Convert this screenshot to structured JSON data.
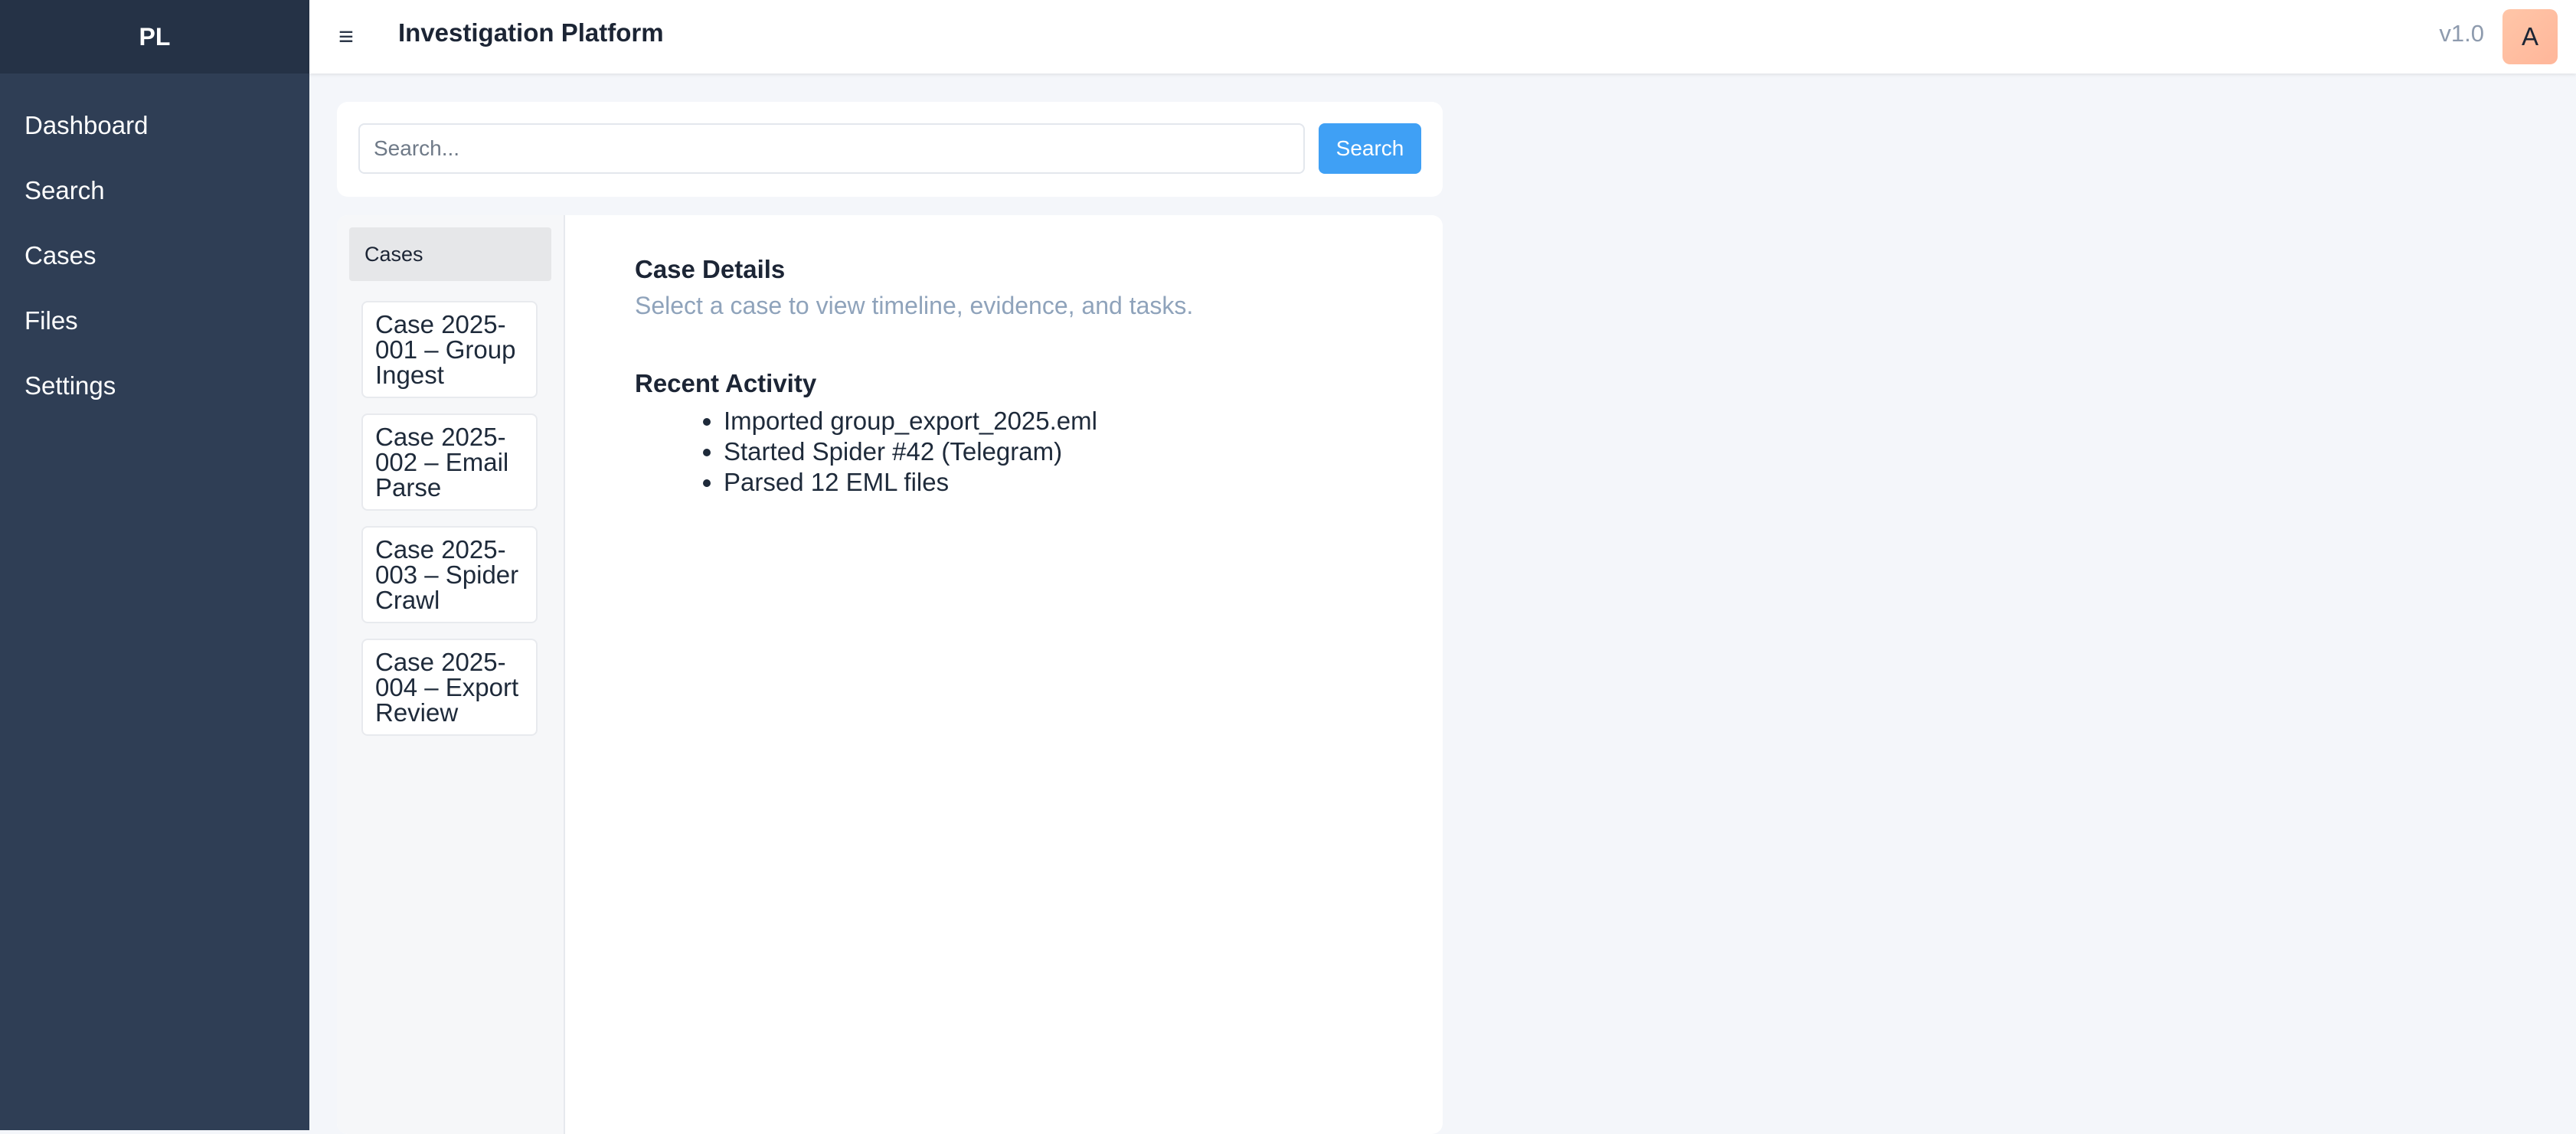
{
  "sidebar": {
    "brand": "PL",
    "items": [
      {
        "label": "Dashboard"
      },
      {
        "label": "Search"
      },
      {
        "label": "Cases"
      },
      {
        "label": "Files"
      },
      {
        "label": "Settings"
      }
    ]
  },
  "header": {
    "menu_icon": "≡",
    "title": "Investigation Platform",
    "version": "v1.0",
    "avatar_initial": "A"
  },
  "search": {
    "placeholder": "Search...",
    "value": "",
    "button_label": "Search"
  },
  "cases": {
    "header": "Cases",
    "items": [
      {
        "label": "Case 2025-001 – Group Ingest"
      },
      {
        "label": "Case 2025-002 – Email Parse"
      },
      {
        "label": "Case 2025-003 – Spider Crawl"
      },
      {
        "label": "Case 2025-004 – Export Review"
      }
    ]
  },
  "details": {
    "title": "Case Details",
    "subtitle": "Select a case to view timeline, evidence, and tasks."
  },
  "activity": {
    "title": "Recent Activity",
    "items": [
      "Imported group_export_2025.eml",
      "Started Spider #42 (Telegram)",
      "Parsed 12 EML files"
    ]
  },
  "colors": {
    "sidebar_bg": "#2f3e55",
    "brand_bg": "#253246",
    "accent": "#3fa0f5",
    "page_bg": "#f4f6fa",
    "subtitle_text": "#8fa3bb"
  }
}
